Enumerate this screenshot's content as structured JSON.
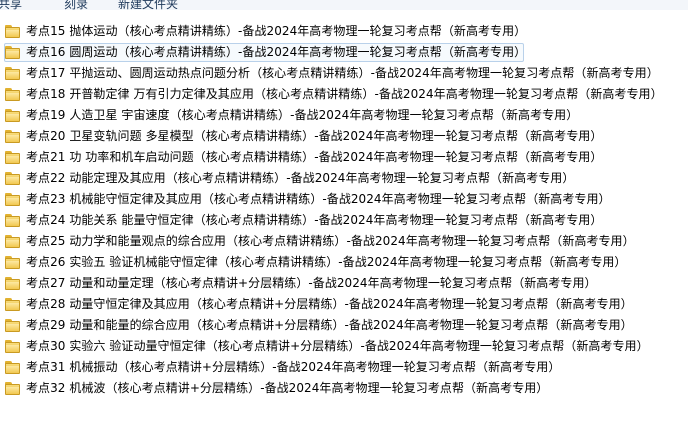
{
  "toolbar": {
    "items": [
      "共享",
      "刻录",
      "新建文件夹"
    ]
  },
  "files": [
    "考点15 抛体运动（核心考点精讲精练）-备战2024年高考物理一轮复习考点帮（新高考专用）",
    "考点16 圆周运动（核心考点精讲精练）-备战2024年高考物理一轮复习考点帮（新高考专用）",
    "考点17 平抛运动、圆周运动热点问题分析（核心考点精讲精练）-备战2024年高考物理一轮复习考点帮（新高考专用）",
    "考点18 开普勒定律 万有引力定律及其应用（核心考点精讲精练）-备战2024年高考物理一轮复习考点帮（新高考专用）",
    "考点19 人造卫星 宇宙速度（核心考点精讲精练）-备战2024年高考物理一轮复习考点帮（新高考专用）",
    "考点20 卫星变轨问题 多星模型（核心考点精讲精练）-备战2024年高考物理一轮复习考点帮（新高考专用）",
    "考点21 功 功率和机车启动问题（核心考点精讲精练）-备战2024年高考物理一轮复习考点帮（新高考专用）",
    "考点22 动能定理及其应用（核心考点精讲精练）-备战2024年高考物理一轮复习考点帮（新高考专用）",
    "考点23 机械能守恒定律及其应用（核心考点精讲精练）-备战2024年高考物理一轮复习考点帮（新高考专用）",
    "考点24 功能关系 能量守恒定律（核心考点精讲精练）-备战2024年高考物理一轮复习考点帮（新高考专用）",
    "考点25 动力学和能量观点的综合应用（核心考点精讲精练）-备战2024年高考物理一轮复习考点帮（新高考专用）",
    "考点26 实验五 验证机械能守恒定律（核心考点精讲精练）-备战2024年高考物理一轮复习考点帮（新高考专用）",
    "考点27 动量和动量定理（核心考点精讲+分层精练）-备战2024年高考物理一轮复习考点帮（新高考专用）",
    "考点28 动量守恒定律及其应用（核心考点精讲+分层精练）-备战2024年高考物理一轮复习考点帮（新高考专用）",
    "考点29 动量和能量的综合应用（核心考点精讲+分层精练）-备战2024年高考物理一轮复习考点帮（新高考专用）",
    "考点30 实验六 验证动量守恒定律（核心考点精讲+分层精练）-备战2024年高考物理一轮复习考点帮（新高考专用）",
    "考点31 机械振动（核心考点精讲+分层精练）-备战2024年高考物理一轮复习考点帮（新高考专用）",
    "考点32 机械波（核心考点精讲+分层精练）-备战2024年高考物理一轮复习考点帮（新高考专用）"
  ],
  "selected_index": 1
}
